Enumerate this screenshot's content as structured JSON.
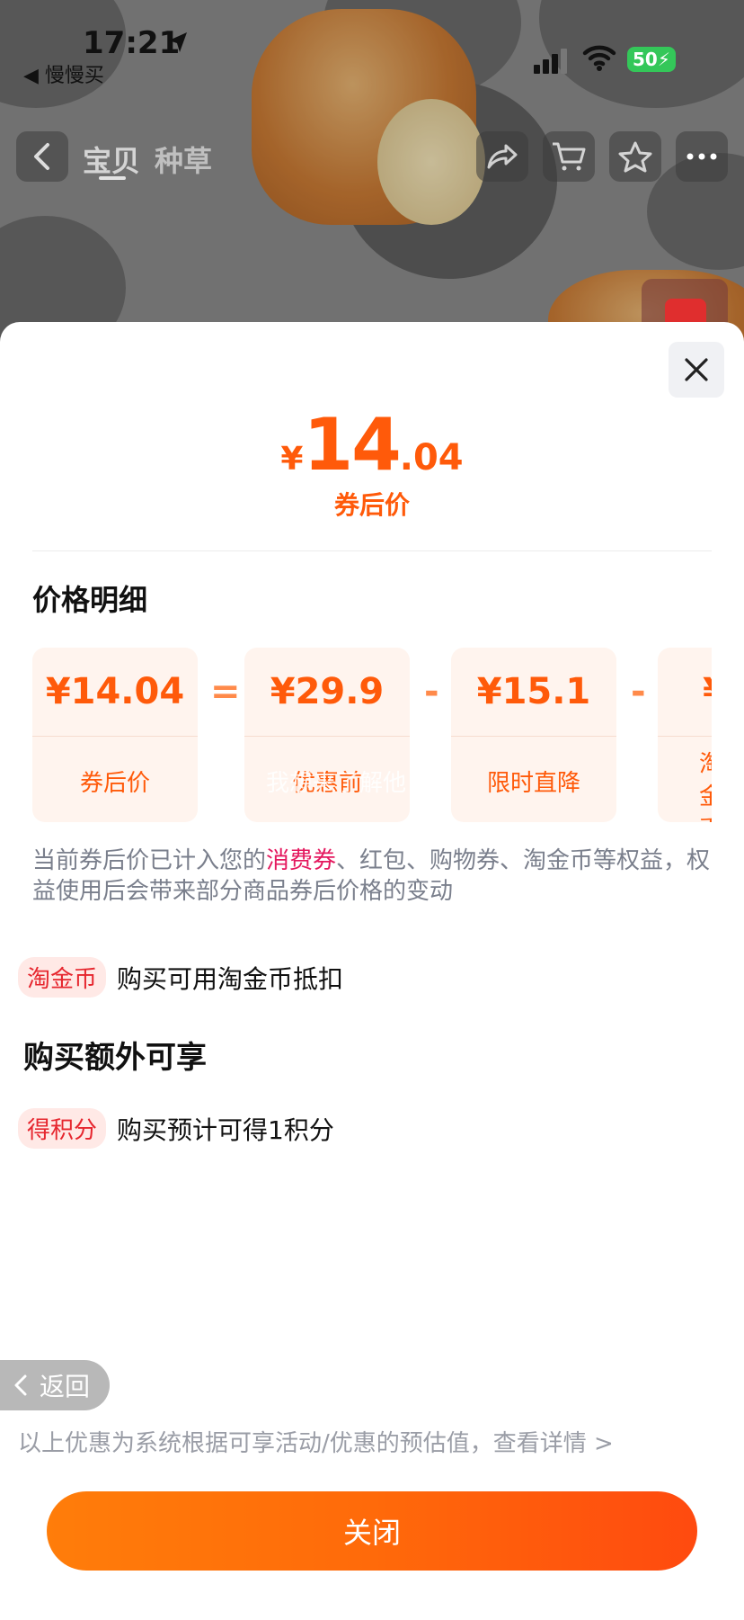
{
  "status_bar": {
    "time": "17:21",
    "back_app": "◀ 慢慢买",
    "battery": "50"
  },
  "nav": {
    "tabs": [
      "宝贝",
      "种草"
    ]
  },
  "sheet": {
    "price": {
      "yen": "¥",
      "int": "14",
      "dec": ".04"
    },
    "price_caption": "券后价",
    "section_title": "价格明细",
    "cards": [
      {
        "value": "¥14.04",
        "label": "券后价"
      },
      {
        "value": "¥29.9",
        "label": "优惠前"
      },
      {
        "value": "¥15.1",
        "label": "限时直降"
      },
      {
        "value": "¥",
        "label": "淘金币抵扣"
      }
    ],
    "operators": [
      "=",
      "-",
      "-"
    ],
    "watermark": "我想来了解他",
    "note_before": "当前券后价已计入您的",
    "note_highlight": "消费券",
    "note_after": "、红包、购物券、淘金币等权益，权益使用后会带来部分商品券后价格的变动",
    "perk1": {
      "tag": "淘金币",
      "text": "购买可用淘金币抵扣"
    },
    "section2": "购买额外可享",
    "perk2": {
      "tag": "得积分",
      "text": "购买预计可得1积分"
    },
    "back_label": "返回",
    "footnote": "以上优惠为系统根据可享活动/优惠的预估值，查看详情 >",
    "close_label": "关闭"
  },
  "colors": {
    "accent": "#ff5a0a",
    "highlight": "#e4185e",
    "tag_text": "#e6262e"
  }
}
